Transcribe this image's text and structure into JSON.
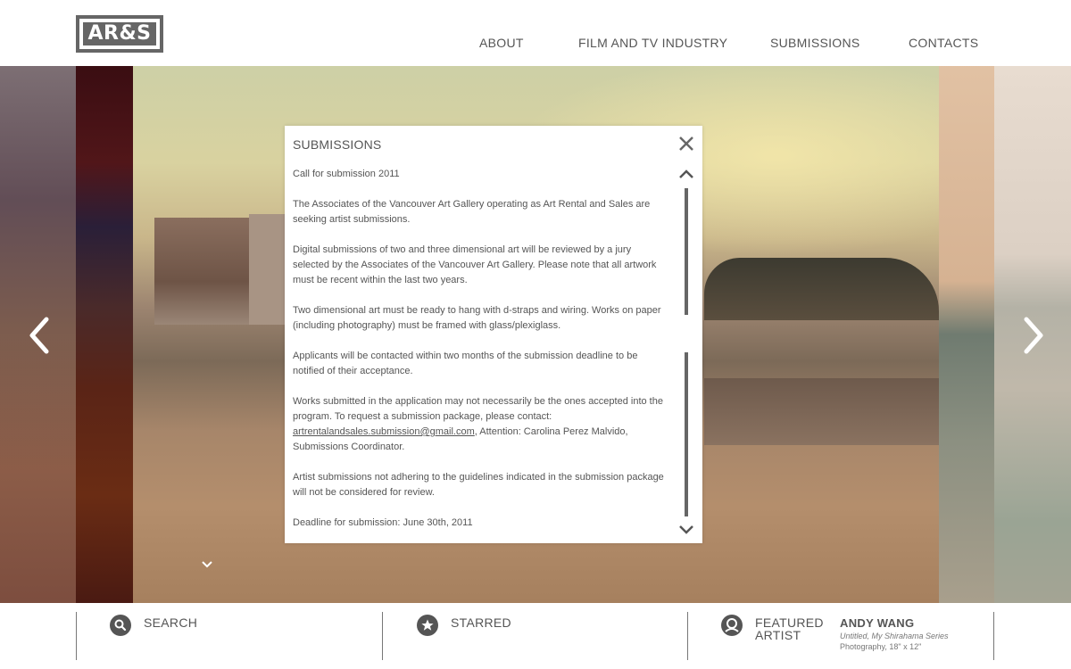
{
  "header": {
    "logo_text": "AR&S",
    "nav": [
      "ABOUT",
      "FILM AND TV INDUSTRY",
      "SUBMISSIONS",
      "CONTACTS"
    ]
  },
  "gallery": {
    "prev_icon": "chevron-left-icon",
    "next_icon": "chevron-right-icon"
  },
  "modal": {
    "title": "SUBMISSIONS",
    "paragraphs": [
      "Call for submission 2011",
      "The Associates of the Vancouver Art Gallery operating as Art Rental and Sales are seeking artist submissions.",
      "Digital submissions of two and three dimensional art will be reviewed by a jury selected by the Associates of the Vancouver Art Gallery. Please note that all artwork must be recent within the last two years.",
      "Two dimensional art must be ready to hang with d-straps and wiring. Works on paper (including photography) must be framed with glass/plexiglass.",
      "Applicants will be contacted within two months of the submission deadline to be notified of their acceptance."
    ],
    "contact_para": {
      "before": "Works submitted in the application may not necessarily be the ones accepted into the program. To request a submission package, please contact: ",
      "email": "artrentalandsales.submission@gmail.com",
      "after": ", Attention: Carolina Perez Malvido, Submissions Coordinator."
    },
    "paragraphs_end": [
      "Artist submissions not adhering to the guidelines indicated in the submission package will not be considered for review.",
      "Deadline for submission: June 30th, 2011"
    ]
  },
  "footer": {
    "search_label": "SEARCH",
    "starred_label": "STARRED",
    "featured_label_1": "FEATURED",
    "featured_label_2": "ARTIST",
    "artist_name": "ANDY WANG",
    "artist_work": "Untitled, My Shirahama Series",
    "artist_medium": "Photography, 18\" x 12\""
  },
  "colors": {
    "text": "#555555",
    "logo": "#666666",
    "divider": "#777777"
  }
}
